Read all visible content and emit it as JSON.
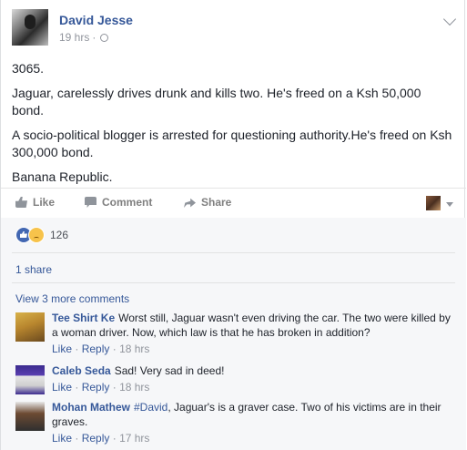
{
  "post": {
    "author": "David Jesse",
    "time": "19 hrs",
    "separator": "·",
    "paragraphs": [
      "3065.",
      "Jaguar, carelessly drives drunk and kills two. He's freed on a Ksh 50,000 bond.",
      "A socio-political blogger is arrested for questioning authority.He's freed on Ksh 300,000 bond.",
      "Banana Republic."
    ]
  },
  "actions": {
    "like": "Like",
    "comment": "Comment",
    "share": "Share"
  },
  "reactions": {
    "count": "126"
  },
  "shares": "1 share",
  "view_more": "View 3 more comments",
  "comment_actions": {
    "like": "Like",
    "reply": "Reply",
    "dot": "·"
  },
  "comments": [
    {
      "name": "Tee Shirt Ke",
      "tag": "",
      "text": "Worst still, Jaguar wasn't even driving the car. The two were killed by a woman driver. Now, which law is that he has broken in addition?",
      "time": "18 hrs"
    },
    {
      "name": "Caleb Seda",
      "tag": "",
      "text": "Sad! Very sad in deed!",
      "time": "18 hrs"
    },
    {
      "name": "Mohan Mathew",
      "tag": "#David",
      "text": ", Jaguar's is a graver case. Two of his victims are in their graves.",
      "time": "17 hrs"
    }
  ],
  "colors": {
    "link": "#365899",
    "meta": "#90949c",
    "text": "#1d2129",
    "ufi_bg": "#f6f7f9"
  }
}
